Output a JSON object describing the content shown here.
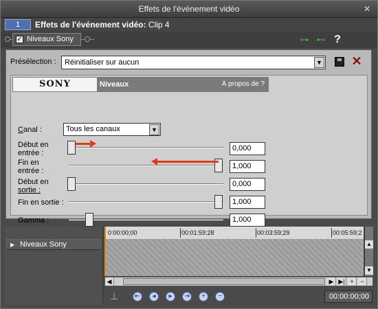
{
  "window": {
    "title": "Effets de l'événement vidéo",
    "close": "✕"
  },
  "header": {
    "index": "1",
    "title_bold": "Effets de l'événement vidéo:",
    "title_rest": " Clip 4"
  },
  "chain": {
    "plugin_label": "Niveaux Sony",
    "checked": "✓"
  },
  "preset": {
    "label": "Présélection :",
    "value": "Réinitialiser sur aucun"
  },
  "plugin": {
    "brand": "SONY",
    "name": "Niveaux",
    "about": "À propos de   ?"
  },
  "canal": {
    "label_u": "C",
    "label_rest": "anal :",
    "value": "Tous les canaux"
  },
  "params": [
    {
      "label_a": "Début en",
      "label_b": "entrée :",
      "value": "0,000",
      "level": 0.0
    },
    {
      "label_a": "Fin en",
      "label_b": "entrée :",
      "value": "1,000",
      "level": 1.0
    },
    {
      "label_a": "Début en",
      "label_b": "sortie :",
      "value": "0,000",
      "level": 0.0
    },
    {
      "label_a": "Fin en sortie :",
      "label_b": "",
      "value": "1,000",
      "level": 1.0
    },
    {
      "label_a": "Gamma :",
      "label_b": "",
      "value": "1,000",
      "level": 0.12
    }
  ],
  "timeline": {
    "track": "Niveaux Sony",
    "ticks": [
      "0:00:00;00",
      "00:01:59;28",
      "00:03:59;29",
      "00:05:59;2"
    ],
    "time": "00:00:00;00"
  },
  "colors": {
    "accent": "#e63a12",
    "badge": "#4f6fb3",
    "cursor": "#e68a00"
  }
}
